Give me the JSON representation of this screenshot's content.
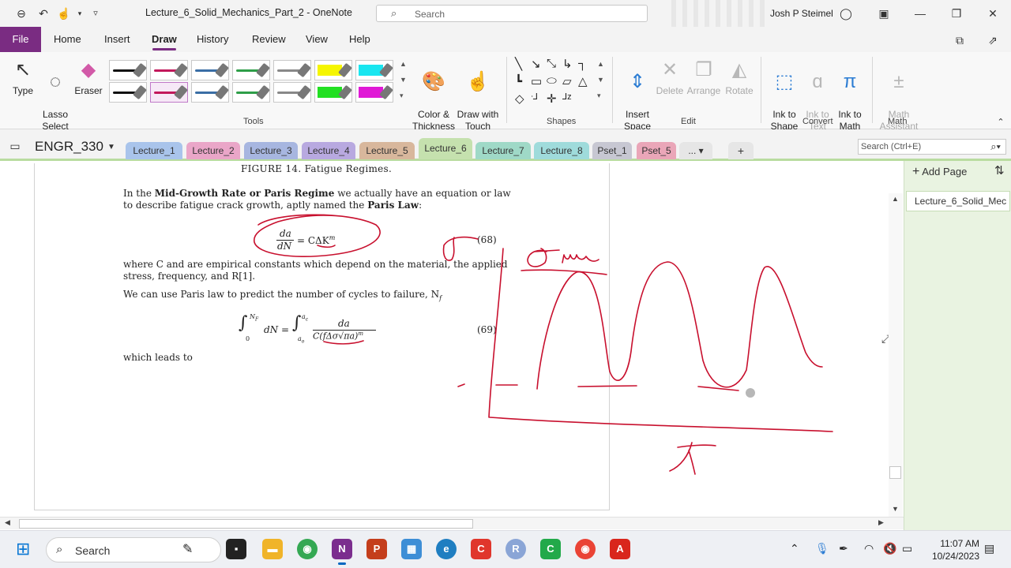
{
  "titlebar": {
    "doc_title": "Lecture_6_Solid_Mechanics_Part_2  -  OneNote",
    "search_placeholder": "Search",
    "user_name": "Josh P Steimel"
  },
  "ribbon_tabs": {
    "file": "File",
    "tabs": [
      "Home",
      "Insert",
      "Draw",
      "History",
      "Review",
      "View",
      "Help"
    ]
  },
  "ribbon": {
    "type": "Type",
    "lasso": "Lasso\nSelect",
    "eraser": "Eraser",
    "tools_label": "Tools",
    "color_thickness": "Color &\nThickness",
    "draw_with_touch": "Draw with\nTouch",
    "shapes_label": "Shapes",
    "insert_space": "Insert\nSpace",
    "delete": "Delete",
    "arrange": "Arrange",
    "rotate": "Rotate",
    "edit_label": "Edit",
    "ink_to_shape": "Ink to\nShape",
    "ink_to_text": "Ink to\nText",
    "ink_to_math": "Ink to\nMath",
    "convert_label": "Convert",
    "math_assistant": "Math\nAssistant",
    "math_label": "Math",
    "pen_colors": [
      "#111111",
      "#c2185b",
      "#3a6ea5",
      "#2e9e48",
      "#888888",
      "#f5f500",
      "#19e6f0",
      "#111111",
      "#c2185b",
      "#3a6ea5",
      "#2e9e48",
      "#888888",
      "#22e022",
      "#e019d6"
    ]
  },
  "notebook": {
    "name": "ENGR_330",
    "sections": [
      {
        "label": "Lecture_1",
        "color": "#a9c4eb"
      },
      {
        "label": "Lecture_2",
        "color": "#eaa6c8"
      },
      {
        "label": "Lecture_3",
        "color": "#a7b6e0"
      },
      {
        "label": "Lecture_4",
        "color": "#b8a9e0"
      },
      {
        "label": "Lecture_5",
        "color": "#d8b79c"
      },
      {
        "label": "Lecture_6",
        "color": "#c5e1ae"
      },
      {
        "label": "Lecture_7",
        "color": "#9fd9c7"
      },
      {
        "label": "Lecture_8",
        "color": "#9fdbdb"
      },
      {
        "label": "Pset_1",
        "color": "#c7c7d2"
      },
      {
        "label": "Pset_5",
        "color": "#eaa6b8"
      }
    ],
    "more": "...",
    "add": "+",
    "search_placeholder": "Search (Ctrl+E)"
  },
  "page_list": {
    "add_page": "Add Page",
    "pages": [
      "Lecture_6_Solid_Mec"
    ]
  },
  "printout": {
    "figure_caption": "FIGURE 14.  Fatigue Regimes.",
    "para1_pre": "In the ",
    "para1_bold": "Mid-Growth Rate or Paris Regime",
    "para1_post": " we actually have an equation or law",
    "para1_line2_pre": "to describe fatigue crack growth, aptly named the ",
    "para1_line2_bold": "Paris Law",
    "para1_line2_post": ":",
    "eq68_num": "da",
    "eq68_den": "dN",
    "eq68_rhs": "= CΔK",
    "eq68_exp": "m",
    "eq68_tag": "(68)",
    "para2_line1": "where C and are empirical constants which depend on the material, the applied",
    "para2_line2": "stress, frequency, and R[1].",
    "para3": "We can use Paris law to predict the number of cycles to failure, N",
    "para3_sub": "f",
    "eq69_int1_upper": "N",
    "eq69_int1_upper_sub": "F",
    "eq69_int1_lower": "0",
    "eq69_dn": "dN =",
    "eq69_int2_upper": "a",
    "eq69_int2_upper_sub": "c",
    "eq69_int2_lower": "a",
    "eq69_int2_lower_sub": "o",
    "eq69_num": "da",
    "eq69_den": "C(fΔσ√πa)",
    "eq69_den_exp": "m",
    "eq69_tag": "(69)",
    "para4": "which leads to"
  },
  "taskbar": {
    "search": "Search",
    "time": "11:07 AM",
    "date": "10/24/2023"
  }
}
